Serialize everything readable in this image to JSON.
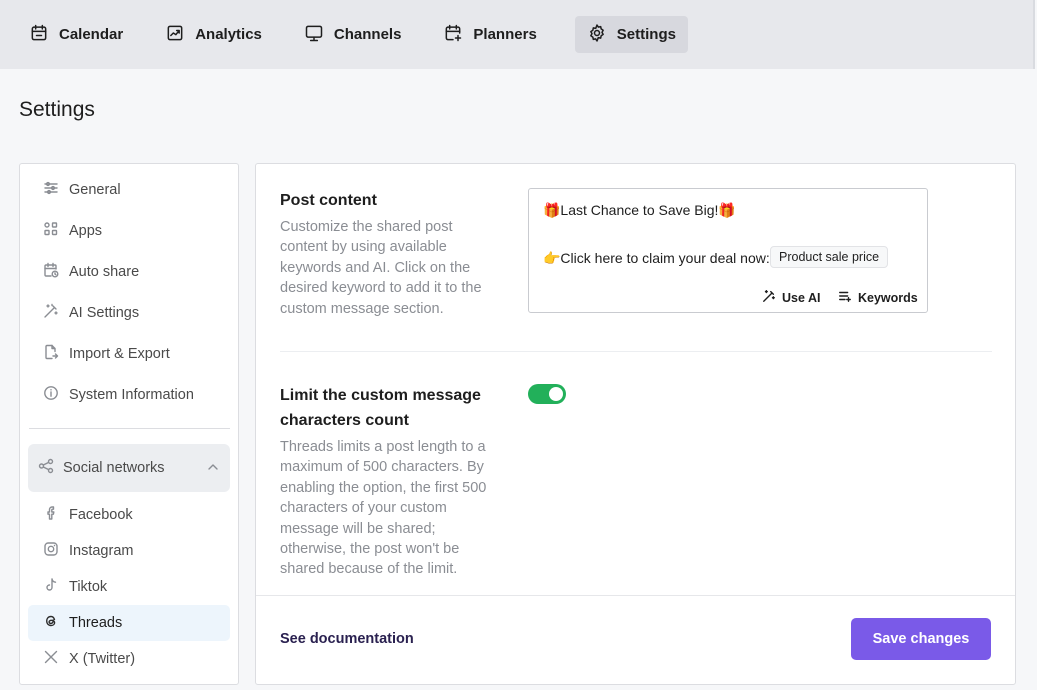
{
  "nav": {
    "tabs": [
      {
        "label": "Calendar",
        "icon": "calendar-icon"
      },
      {
        "label": "Analytics",
        "icon": "analytics-icon"
      },
      {
        "label": "Channels",
        "icon": "monitor-icon"
      },
      {
        "label": "Planners",
        "icon": "calendar-plus-icon"
      },
      {
        "label": "Settings",
        "icon": "gear-icon",
        "active": true
      }
    ]
  },
  "page": {
    "title": "Settings"
  },
  "sidebar": {
    "items": [
      {
        "label": "General",
        "icon": "sliders-icon"
      },
      {
        "label": "Apps",
        "icon": "apps-grid-icon"
      },
      {
        "label": "Auto share",
        "icon": "calendar-clock-icon"
      },
      {
        "label": "AI Settings",
        "icon": "magic-wand-icon"
      },
      {
        "label": "Import & Export",
        "icon": "file-export-icon"
      },
      {
        "label": "System Information",
        "icon": "info-icon"
      }
    ],
    "social": {
      "label": "Social networks",
      "expanded": true,
      "networks": [
        {
          "label": "Facebook",
          "icon": "facebook-icon"
        },
        {
          "label": "Instagram",
          "icon": "instagram-icon"
        },
        {
          "label": "Tiktok",
          "icon": "tiktok-icon"
        },
        {
          "label": "Threads",
          "icon": "threads-icon",
          "active": true
        },
        {
          "label": "X (Twitter)",
          "icon": "x-twitter-icon"
        }
      ]
    }
  },
  "main": {
    "post_content": {
      "title": "Post content",
      "description": "Customize the shared post content by using available keywords and AI. Click on the desired keyword to add it to the custom message section.",
      "editor": {
        "line1": "🎁Last Chance to Save Big!🎁",
        "line2": "👉Click here to claim your deal now:",
        "keyword_chip": "Product sale price",
        "use_ai_label": "Use AI",
        "keywords_label": "Keywords"
      }
    },
    "limit": {
      "title": "Limit the custom message characters count",
      "description": "Threads limits a post length to a maximum of 500 characters. By enabling the option, the first 500 characters of your custom message will be shared; otherwise, the post won't be shared because of the limit.",
      "enabled": true
    },
    "footer": {
      "doc_link": "See documentation",
      "save_label": "Save changes"
    }
  },
  "colors": {
    "accent": "#7a5ae8",
    "toggle_on": "#22b05a",
    "active_sub_bg": "#edf5fc"
  }
}
